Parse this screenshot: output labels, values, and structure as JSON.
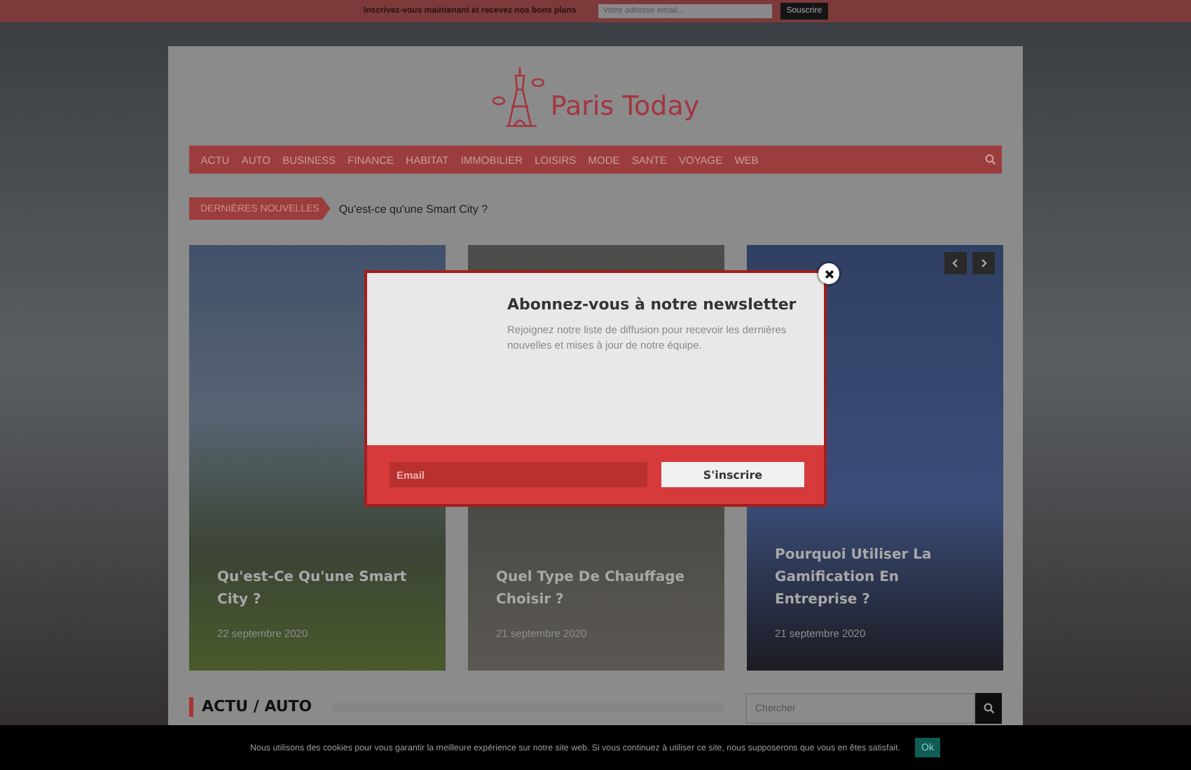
{
  "topbar": {
    "text": "Inscrivez-vous maintenant et recevez nos bons plans",
    "placeholder": "Votre adresse email...",
    "button": "Souscrire"
  },
  "logo": {
    "text": "Paris Today"
  },
  "nav": {
    "items": [
      "ACTU",
      "AUTO",
      "BUSINESS",
      "FINANCE",
      "HABITAT",
      "IMMOBILIER",
      "LOISIRS",
      "MODE",
      "SANTE",
      "VOYAGE",
      "WEB"
    ]
  },
  "ticker": {
    "label": "DERNIÈRES NOUVELLES",
    "headline": "Qu'est-ce qu'une Smart City ?"
  },
  "cards": [
    {
      "title": "Qu'est-Ce Qu'une Smart City ?",
      "date": "22 septembre 2020"
    },
    {
      "title": "Quel Type De Chauffage Choisir ?",
      "date": "21 septembre 2020"
    },
    {
      "title": "Pourquoi Utiliser La Gamification En Entreprise ?",
      "date": "21 septembre 2020"
    }
  ],
  "section": {
    "title": "ACTU / AUTO"
  },
  "search": {
    "placeholder": "Chercher"
  },
  "modal": {
    "title": "Abonnez-vous à notre newsletter",
    "text": "Rejoignez notre liste de diffusion pour recevoir les dernières nouvelles et mises à jour de notre équipe.",
    "placeholder": "Email",
    "button": "S'inscrire"
  },
  "cookie": {
    "text": "Nous utilisons des cookies pour vous garantir la meilleure expérience sur notre site web. Si vous continuez à utiliser ce site, nous supposerons que vous en êtes satisfait.",
    "button": "Ok"
  }
}
